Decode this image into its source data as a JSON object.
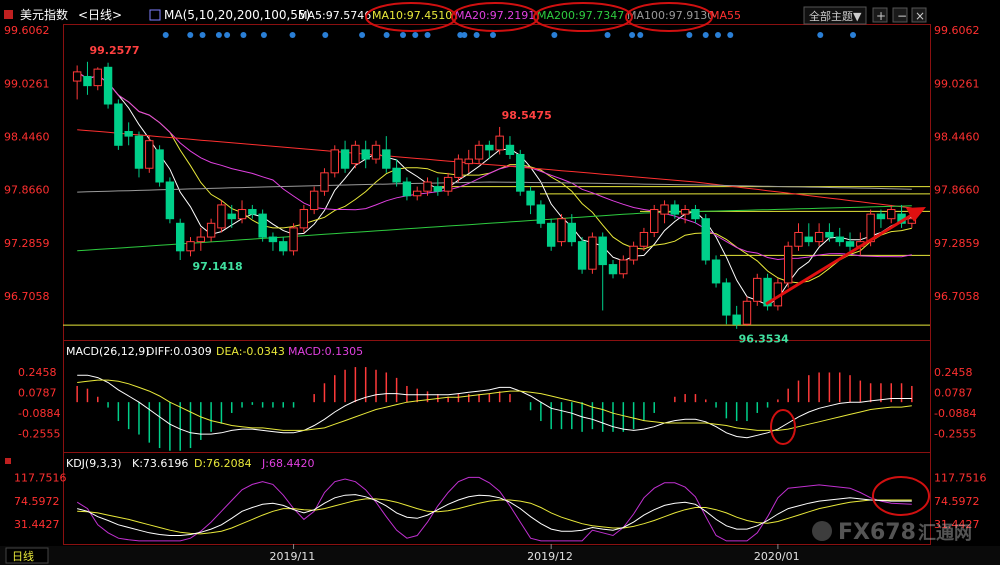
{
  "toolbar": {
    "symbol": "美元指数",
    "period": "<日线>",
    "ma_label": "MA(5,10,20,200,100,55)",
    "ma_values": [
      {
        "text": "MA5:97.5746",
        "color": "#ffffff"
      },
      {
        "text": "MA10:97.4510",
        "color": "#e8e83a"
      },
      {
        "text": "MA20:97.2191",
        "color": "#e040e0"
      },
      {
        "text": "MA200:97.7347",
        "color": "#2ecc40"
      },
      {
        "text": "MA100:97.9130",
        "color": "#9a9a9a"
      },
      {
        "text": "MA55",
        "color": "#ff3030"
      }
    ],
    "theme_button": "全部主题▼"
  },
  "macd_header": {
    "label": "MACD(26,12,9)",
    "diff": "DIFF:0.0309",
    "dea": "DEA:-0.0343",
    "macd": "MACD:0.1305"
  },
  "kdj_header": {
    "label": "KDJ(9,3,3)",
    "k": "K:73.6196",
    "d": "D:76.2084",
    "j": "J:68.4420"
  },
  "bottom_bar": {
    "period_tab": "日线",
    "x_ticks": [
      "2019/11",
      "2019/12",
      "2020/01"
    ]
  },
  "watermark": {
    "text": "FX678",
    "cn": "汇通网"
  },
  "colors": {
    "up": "#ff3a3a",
    "down": "#00d08a",
    "bg": "#000000",
    "axis_text_red": "#ff3030",
    "ma5": "#ffffff",
    "ma10": "#e8e83a",
    "ma20": "#e040e0",
    "ma200": "#2ecc40",
    "ma100": "#9a9a9a",
    "ma55": "#ff3030",
    "annotation": "#e01010"
  },
  "chart_data": [
    {
      "type": "candlestick",
      "title": "美元指数 <日线>",
      "y_ticks": [
        99.6062,
        99.0261,
        98.446,
        97.866,
        97.2859,
        96.7058
      ],
      "ylim": [
        96.25,
        99.65
      ],
      "annotations": [
        {
          "text": "99.2577",
          "value": 99.2577
        },
        {
          "text": "97.1418",
          "value": 97.1418
        },
        {
          "text": "98.5475",
          "value": 98.5475
        },
        {
          "text": "96.3534",
          "value": 96.3534
        }
      ],
      "horizontal_lines": [
        97.9,
        97.82,
        97.63,
        97.15,
        96.39
      ],
      "candles": [
        [
          99.05,
          99.15,
          98.85,
          99.22
        ],
        [
          99.1,
          99.0,
          98.9,
          99.26
        ],
        [
          99.0,
          99.18,
          98.95,
          99.2
        ],
        [
          99.2,
          98.8,
          98.75,
          99.25
        ],
        [
          98.8,
          98.35,
          98.3,
          98.85
        ],
        [
          98.5,
          98.45,
          98.35,
          98.6
        ],
        [
          98.45,
          98.1,
          98.0,
          98.5
        ],
        [
          98.1,
          98.4,
          98.05,
          98.45
        ],
        [
          98.3,
          97.95,
          97.9,
          98.35
        ],
        [
          97.95,
          97.55,
          97.5,
          98.0
        ],
        [
          97.5,
          97.2,
          97.1,
          97.55
        ],
        [
          97.2,
          97.3,
          97.14,
          97.35
        ],
        [
          97.3,
          97.35,
          97.2,
          97.45
        ],
        [
          97.35,
          97.5,
          97.3,
          97.55
        ],
        [
          97.45,
          97.7,
          97.4,
          97.75
        ],
        [
          97.6,
          97.55,
          97.45,
          97.7
        ],
        [
          97.55,
          97.65,
          97.5,
          97.75
        ],
        [
          97.65,
          97.6,
          97.55,
          97.7
        ],
        [
          97.6,
          97.35,
          97.3,
          97.65
        ],
        [
          97.35,
          97.3,
          97.2,
          97.4
        ],
        [
          97.3,
          97.2,
          97.15,
          97.35
        ],
        [
          97.2,
          97.45,
          97.15,
          97.5
        ],
        [
          97.45,
          97.65,
          97.4,
          97.7
        ],
        [
          97.65,
          97.85,
          97.6,
          97.9
        ],
        [
          97.85,
          98.05,
          97.8,
          98.1
        ],
        [
          98.05,
          98.3,
          98.0,
          98.35
        ],
        [
          98.3,
          98.1,
          98.05,
          98.4
        ],
        [
          98.15,
          98.35,
          98.1,
          98.4
        ],
        [
          98.3,
          98.2,
          98.1,
          98.4
        ],
        [
          98.2,
          98.35,
          98.15,
          98.4
        ],
        [
          98.3,
          98.1,
          98.05,
          98.45
        ],
        [
          98.1,
          97.95,
          97.9,
          98.2
        ],
        [
          97.95,
          97.8,
          97.75,
          98.0
        ],
        [
          97.8,
          97.85,
          97.75,
          97.9
        ],
        [
          97.85,
          97.95,
          97.8,
          98.0
        ],
        [
          97.9,
          97.85,
          97.8,
          98.0
        ],
        [
          97.85,
          98.0,
          97.8,
          98.05
        ],
        [
          98.0,
          98.2,
          97.95,
          98.25
        ],
        [
          98.15,
          98.2,
          98.05,
          98.3
        ],
        [
          98.2,
          98.35,
          98.15,
          98.4
        ],
        [
          98.35,
          98.3,
          98.2,
          98.4
        ],
        [
          98.3,
          98.45,
          98.25,
          98.55
        ],
        [
          98.35,
          98.25,
          98.2,
          98.45
        ],
        [
          98.25,
          97.85,
          97.8,
          98.3
        ],
        [
          97.85,
          97.7,
          97.6,
          97.9
        ],
        [
          97.7,
          97.5,
          97.45,
          97.75
        ],
        [
          97.5,
          97.25,
          97.2,
          97.55
        ],
        [
          97.3,
          97.55,
          97.25,
          97.6
        ],
        [
          97.5,
          97.3,
          97.25,
          97.6
        ],
        [
          97.3,
          97.0,
          96.95,
          97.35
        ],
        [
          97.0,
          97.35,
          96.95,
          97.4
        ],
        [
          97.35,
          97.05,
          96.55,
          97.4
        ],
        [
          97.05,
          96.95,
          96.9,
          97.1
        ],
        [
          96.95,
          97.1,
          96.9,
          97.15
        ],
        [
          97.1,
          97.25,
          97.05,
          97.3
        ],
        [
          97.25,
          97.4,
          97.2,
          97.45
        ],
        [
          97.4,
          97.65,
          97.35,
          97.7
        ],
        [
          97.6,
          97.7,
          97.5,
          97.75
        ],
        [
          97.7,
          97.6,
          97.55,
          97.75
        ],
        [
          97.6,
          97.65,
          97.5,
          97.7
        ],
        [
          97.65,
          97.55,
          97.5,
          97.7
        ],
        [
          97.55,
          97.1,
          97.05,
          97.6
        ],
        [
          97.1,
          96.85,
          96.8,
          97.15
        ],
        [
          96.85,
          96.5,
          96.4,
          96.9
        ],
        [
          96.5,
          96.4,
          96.35,
          96.6
        ],
        [
          96.4,
          96.65,
          96.38,
          96.7
        ],
        [
          96.65,
          96.9,
          96.6,
          96.95
        ],
        [
          96.9,
          96.6,
          96.55,
          96.95
        ],
        [
          96.6,
          96.85,
          96.55,
          96.9
        ],
        [
          96.85,
          97.25,
          96.8,
          97.3
        ],
        [
          97.25,
          97.4,
          97.2,
          97.5
        ],
        [
          97.35,
          97.3,
          97.25,
          97.5
        ],
        [
          97.3,
          97.4,
          97.25,
          97.5
        ],
        [
          97.4,
          97.35,
          97.3,
          97.5
        ],
        [
          97.35,
          97.3,
          97.25,
          97.45
        ],
        [
          97.3,
          97.25,
          97.15,
          97.4
        ],
        [
          97.25,
          97.3,
          97.15,
          97.4
        ],
        [
          97.3,
          97.6,
          97.25,
          97.65
        ],
        [
          97.6,
          97.55,
          97.45,
          97.65
        ],
        [
          97.55,
          97.65,
          97.5,
          97.7
        ],
        [
          97.6,
          97.5,
          97.45,
          97.7
        ],
        [
          97.5,
          97.55,
          97.45,
          97.6
        ]
      ]
    },
    {
      "type": "macd",
      "title": "MACD(26,12,9)",
      "y_ticks": [
        0.2458,
        0.0787,
        -0.0884,
        -0.2555
      ],
      "ylim": [
        -0.39,
        0.36
      ],
      "series": [
        {
          "name": "DIFF",
          "values": [
            0.22,
            0.22,
            0.2,
            0.16,
            0.1,
            0.05,
            0.0,
            -0.06,
            -0.12,
            -0.18,
            -0.22,
            -0.25,
            -0.26,
            -0.26,
            -0.25,
            -0.23,
            -0.22,
            -0.22,
            -0.23,
            -0.24,
            -0.25,
            -0.25,
            -0.23,
            -0.19,
            -0.14,
            -0.08,
            -0.03,
            0.01,
            0.04,
            0.06,
            0.07,
            0.07,
            0.06,
            0.06,
            0.06,
            0.06,
            0.06,
            0.07,
            0.08,
            0.09,
            0.1,
            0.12,
            0.12,
            0.09,
            0.05,
            0.0,
            -0.05,
            -0.07,
            -0.09,
            -0.12,
            -0.14,
            -0.17,
            -0.2,
            -0.22,
            -0.23,
            -0.22,
            -0.2,
            -0.17,
            -0.15,
            -0.14,
            -0.14,
            -0.16,
            -0.2,
            -0.25,
            -0.28,
            -0.29,
            -0.27,
            -0.25,
            -0.22,
            -0.17,
            -0.12,
            -0.08,
            -0.05,
            -0.03,
            -0.01,
            0.0,
            0.0,
            0.01,
            0.02,
            0.03,
            0.03,
            0.03
          ]
        },
        {
          "name": "DEA",
          "values": [
            0.16,
            0.17,
            0.18,
            0.18,
            0.17,
            0.15,
            0.12,
            0.09,
            0.05,
            0.0,
            -0.04,
            -0.08,
            -0.12,
            -0.15,
            -0.17,
            -0.19,
            -0.2,
            -0.21,
            -0.21,
            -0.22,
            -0.23,
            -0.23,
            -0.23,
            -0.22,
            -0.21,
            -0.18,
            -0.15,
            -0.12,
            -0.09,
            -0.06,
            -0.04,
            -0.02,
            0.0,
            0.01,
            0.02,
            0.03,
            0.04,
            0.04,
            0.05,
            0.06,
            0.07,
            0.08,
            0.09,
            0.09,
            0.08,
            0.07,
            0.05,
            0.03,
            0.01,
            -0.01,
            -0.04,
            -0.06,
            -0.09,
            -0.11,
            -0.13,
            -0.15,
            -0.16,
            -0.17,
            -0.17,
            -0.17,
            -0.17,
            -0.17,
            -0.18,
            -0.19,
            -0.21,
            -0.22,
            -0.23,
            -0.23,
            -0.23,
            -0.22,
            -0.2,
            -0.18,
            -0.16,
            -0.14,
            -0.12,
            -0.1,
            -0.08,
            -0.06,
            -0.05,
            -0.04,
            -0.04,
            -0.03
          ]
        }
      ]
    },
    {
      "type": "kdj",
      "title": "KDJ(9,3,3)",
      "y_ticks": [
        117.7516,
        74.5972,
        31.4427
      ],
      "ylim": [
        -2,
        128
      ],
      "series": [
        {
          "name": "K",
          "values": [
            60,
            55,
            45,
            38,
            30,
            25,
            20,
            15,
            12,
            10,
            10,
            12,
            16,
            22,
            30,
            42,
            55,
            62,
            68,
            70,
            66,
            58,
            52,
            58,
            70,
            80,
            85,
            86,
            82,
            75,
            65,
            52,
            44,
            42,
            48,
            58,
            68,
            76,
            82,
            85,
            84,
            80,
            72,
            60,
            45,
            32,
            22,
            18,
            18,
            20,
            25,
            22,
            20,
            25,
            35,
            48,
            58,
            66,
            70,
            72,
            68,
            55,
            40,
            28,
            22,
            22,
            28,
            38,
            50,
            60,
            65,
            70,
            74,
            76,
            78,
            80,
            78,
            76,
            75,
            74,
            74,
            74
          ]
        },
        {
          "name": "D",
          "values": [
            55,
            54,
            52,
            48,
            44,
            40,
            35,
            30,
            25,
            20,
            16,
            14,
            13,
            15,
            18,
            24,
            32,
            40,
            48,
            55,
            60,
            60,
            58,
            57,
            60,
            65,
            70,
            75,
            78,
            78,
            76,
            72,
            66,
            60,
            55,
            54,
            56,
            60,
            65,
            70,
            74,
            76,
            76,
            74,
            70,
            62,
            52,
            44,
            38,
            32,
            28,
            26,
            24,
            24,
            27,
            32,
            38,
            45,
            52,
            58,
            62,
            62,
            58,
            52,
            44,
            38,
            34,
            33,
            36,
            42,
            48,
            54,
            60,
            64,
            68,
            72,
            74,
            76,
            76,
            76,
            76,
            76
          ]
        },
        {
          "name": "J",
          "values": [
            72,
            60,
            30,
            15,
            5,
            2,
            0,
            0,
            0,
            0,
            0,
            5,
            18,
            35,
            55,
            75,
            95,
            105,
            110,
            105,
            85,
            60,
            40,
            55,
            90,
            110,
            115,
            110,
            95,
            72,
            45,
            20,
            5,
            10,
            35,
            65,
            90,
            110,
            118,
            118,
            108,
            92,
            65,
            35,
            5,
            0,
            0,
            0,
            0,
            0,
            20,
            15,
            10,
            25,
            50,
            80,
            98,
            108,
            108,
            100,
            82,
            45,
            10,
            0,
            0,
            0,
            15,
            45,
            80,
            98,
            100,
            102,
            104,
            102,
            100,
            98,
            90,
            80,
            74,
            70,
            69,
            68
          ]
        }
      ],
      "histogram": [
        0.06,
        0.05,
        0.02,
        -0.02,
        -0.07,
        -0.1,
        -0.12,
        -0.15,
        -0.17,
        -0.18,
        -0.18,
        -0.17,
        -0.14,
        -0.11,
        -0.08,
        -0.04,
        -0.02,
        -0.01,
        -0.02,
        -0.02,
        -0.02,
        -0.02,
        0.0,
        0.03,
        0.07,
        0.1,
        0.12,
        0.13,
        0.13,
        0.12,
        0.11,
        0.09,
        0.06,
        0.05,
        0.04,
        0.03,
        0.02,
        0.03,
        0.03,
        0.03,
        0.03,
        0.04,
        0.03,
        0.0,
        -0.03,
        -0.07,
        -0.1,
        -0.1,
        -0.1,
        -0.11,
        -0.1,
        -0.11,
        -0.11,
        -0.11,
        -0.1,
        -0.07,
        -0.04,
        0.0,
        0.02,
        0.03,
        0.03,
        0.01,
        -0.02,
        -0.06,
        -0.07,
        -0.07,
        -0.04,
        -0.02,
        0.01,
        0.05,
        0.08,
        0.1,
        0.11,
        0.11,
        0.11,
        0.1,
        0.08,
        0.07,
        0.07,
        0.07,
        0.07,
        0.06
      ]
    }
  ]
}
